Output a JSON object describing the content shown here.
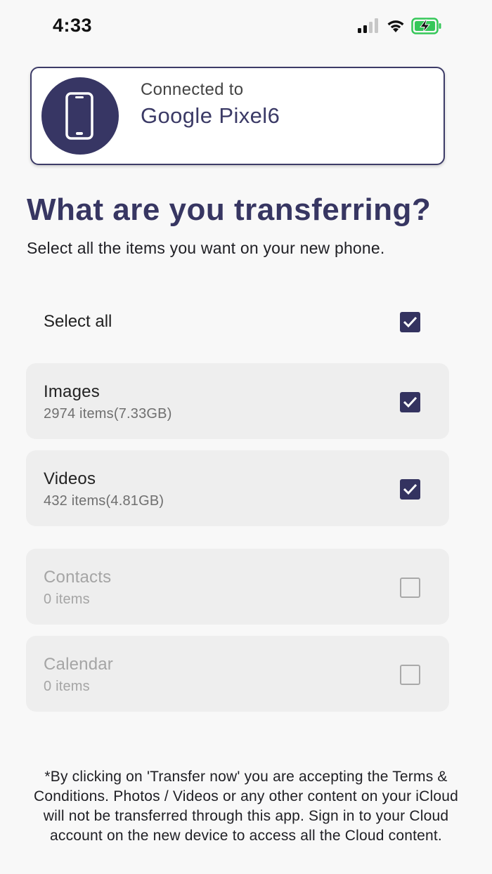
{
  "status_bar": {
    "time": "4:33"
  },
  "connection": {
    "label": "Connected to",
    "device_name": "Google Pixel6",
    "icon": "smartphone-icon"
  },
  "header": {
    "title": "What are you transferring?",
    "subtitle": "Select all the items you want on your new phone."
  },
  "select_all": {
    "label": "Select all",
    "checked": true
  },
  "items": [
    {
      "name": "Images",
      "count": "2974 items(7.33GB)",
      "checked": true,
      "enabled": true
    },
    {
      "name": "Videos",
      "count": "432 items(4.81GB)",
      "checked": true,
      "enabled": true
    },
    {
      "name": "Contacts",
      "count": "0 items",
      "checked": false,
      "enabled": false
    },
    {
      "name": "Calendar",
      "count": "0 items",
      "checked": false,
      "enabled": false
    }
  ],
  "footer": {
    "note": "*By clicking on 'Transfer now' you are accepting the Terms & Conditions. Photos / Videos or any other content on your iCloud will not be transferred through this app. Sign in to your Cloud account on the new device to access all the Cloud content."
  },
  "colors": {
    "accent": "#373662",
    "battery": "#35c759",
    "card": "#eeeeee",
    "background": "#f8f8f8"
  }
}
